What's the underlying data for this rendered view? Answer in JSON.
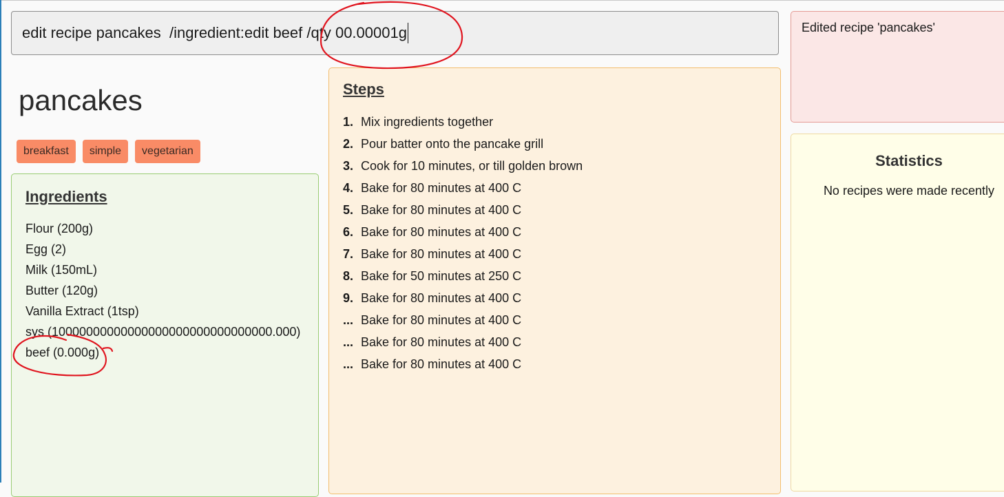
{
  "command": {
    "text": "edit recipe pancakes  /ingredient:edit beef /qty 00.00001g"
  },
  "result": {
    "message": "Edited recipe 'pancakes'"
  },
  "recipe": {
    "name": "pancakes",
    "tags": [
      "breakfast",
      "simple",
      "vegetarian"
    ]
  },
  "ingredients": {
    "title": "Ingredients",
    "items": [
      "Flour (200g)",
      "Egg (2)",
      "Milk (150mL)",
      "Butter (120g)",
      "Vanilla Extract (1tsp)",
      "sys (10000000000000000000000000000000.000)",
      "beef (0.000g)"
    ]
  },
  "steps": {
    "title": "Steps",
    "items": [
      {
        "num": "1.",
        "text": "Mix ingredients together"
      },
      {
        "num": "2.",
        "text": "Pour batter onto the pancake grill"
      },
      {
        "num": "3.",
        "text": "Cook for 10 minutes, or till golden brown"
      },
      {
        "num": "4.",
        "text": "Bake for 80 minutes at 400 C"
      },
      {
        "num": "5.",
        "text": "Bake for 80 minutes at 400 C"
      },
      {
        "num": "6.",
        "text": "Bake for 80 minutes at 400 C"
      },
      {
        "num": "7.",
        "text": "Bake for 80 minutes at 400 C"
      },
      {
        "num": "8.",
        "text": "Bake for 50 minutes at 250 C"
      },
      {
        "num": "9.",
        "text": "Bake for 80 minutes at 400 C"
      },
      {
        "num": "...",
        "text": "Bake for 80 minutes at 400 C"
      },
      {
        "num": "...",
        "text": "Bake for 80 minutes at 400 C"
      },
      {
        "num": "...",
        "text": "Bake for 80 minutes at 400 C"
      }
    ]
  },
  "statistics": {
    "title": "Statistics",
    "empty_message": "No recipes were made recently"
  },
  "colors": {
    "annotation": "#e0141e",
    "tag": "#f98b66",
    "ingredients_border": "#99cc73",
    "steps_border": "#f2bd6e",
    "result_border": "#e49a94"
  }
}
